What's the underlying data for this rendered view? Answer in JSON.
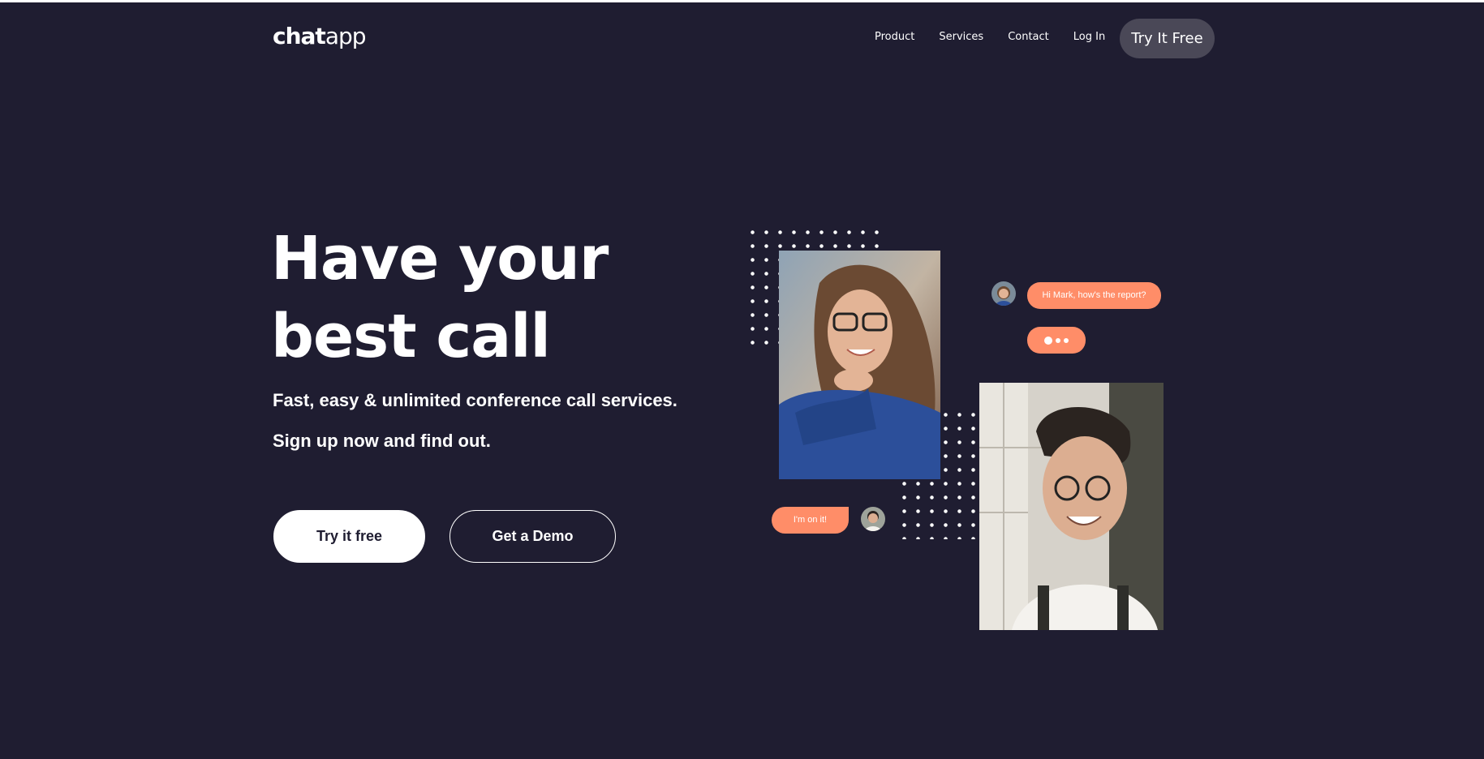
{
  "brand": {
    "logo_bold": "chat",
    "logo_light": "app"
  },
  "nav": {
    "links": [
      "Product",
      "Services",
      "Contact",
      "Log In"
    ],
    "cta": "Try It Free"
  },
  "hero": {
    "title_line1": "Have your",
    "title_line2": "best call",
    "subtitle_line1": "Fast, easy & unlimited conference call services.",
    "subtitle_line2": "Sign up now and find out.",
    "primary_button": "Try it free",
    "secondary_button": "Get a Demo"
  },
  "chat": {
    "message_incoming": "Hi Mark, how's the report?",
    "message_outgoing": "I'm on it!"
  },
  "colors": {
    "background": "#1f1d31",
    "accent": "#ff8d68",
    "nav_cta_bg": "#4a4857",
    "text": "#ffffff"
  },
  "icons": [
    "typing-indicator-icon"
  ]
}
